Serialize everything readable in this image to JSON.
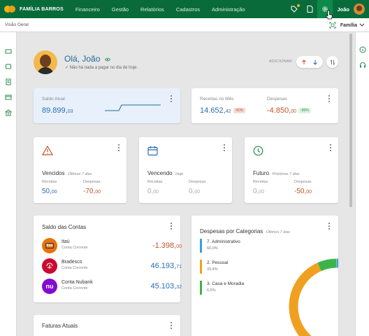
{
  "brand": {
    "name": "FAMÍLIA BARROS"
  },
  "menu": [
    "Financeiro",
    "Gestão",
    "Relatórios",
    "Cadastros",
    "Administração"
  ],
  "user": {
    "name": "João"
  },
  "breadcrumb": "Visão Geral",
  "family_select": "Família",
  "greeting": {
    "title": "Olá, João",
    "subtitle": "Não há nada a pagar no dia de hoje."
  },
  "actions": {
    "add_label": "ADICIONAR"
  },
  "saldo": {
    "label": "Saldo Atual",
    "value": "89.899,",
    "cents": "03"
  },
  "receitas_despesas": {
    "receitas_label": "Receitas no Mês",
    "receitas_value": "14.652,",
    "receitas_cents": "42",
    "receitas_chip": "-80%",
    "despesas_label": "Despesas",
    "despesas_value": "-4.850,",
    "despesas_cents": "00",
    "despesas_chip": "-85%"
  },
  "periods": [
    {
      "title": "Vencidos",
      "period": "Últimos 7 dias",
      "rec_label": "Receitas",
      "rec": "50,",
      "rec_c": "00",
      "desp_label": "Despesas",
      "desp": "-70,",
      "desp_c": "00"
    },
    {
      "title": "Vencendo",
      "period": "Hoje",
      "rec_label": "Receitas",
      "rec": "0,",
      "rec_c": "00",
      "desp_label": "Despesas",
      "desp": "0,",
      "desp_c": "00"
    },
    {
      "title": "Futuro",
      "period": "Próximos 7 dias",
      "rec_label": "Receitas",
      "rec": "0,",
      "rec_c": "00",
      "desp_label": "Despesas",
      "desp": "-50,",
      "desp_c": "00"
    }
  ],
  "accounts": {
    "title": "Saldo das Contas",
    "items": [
      {
        "name": "Itaú",
        "type": "Conta Corrente",
        "value": "-1.398,",
        "cents": "00",
        "logo_text": "Itaú"
      },
      {
        "name": "Bradesco",
        "type": "Conta Corrente",
        "value": "46.193,",
        "cents": "71",
        "logo_text": ""
      },
      {
        "name": "Conta Nubank",
        "type": "Conta Corrente",
        "value": "45.103,",
        "cents": "32",
        "logo_text": "nu"
      }
    ]
  },
  "faturas": {
    "title": "Faturas Atuais"
  },
  "categories": {
    "title": "Despesas por Categorias",
    "period": "Últimos 7 dias",
    "items": [
      {
        "name": "7. Administrativo",
        "pct": "60,0%",
        "color": "#3a9ee4",
        "share": 0.6
      },
      {
        "name": "2. Pessoal",
        "pct": "33,4%",
        "color": "#f0a020",
        "share": 0.334
      },
      {
        "name": "3. Casa e Moradia",
        "pct": "6,5%",
        "color": "#3cb44b",
        "share": 0.065
      }
    ]
  },
  "colors": {
    "topbar": "#0a6b3a",
    "accent": "#2a6db0",
    "negative": "#c0562a",
    "positive": "#2a8b4d"
  }
}
